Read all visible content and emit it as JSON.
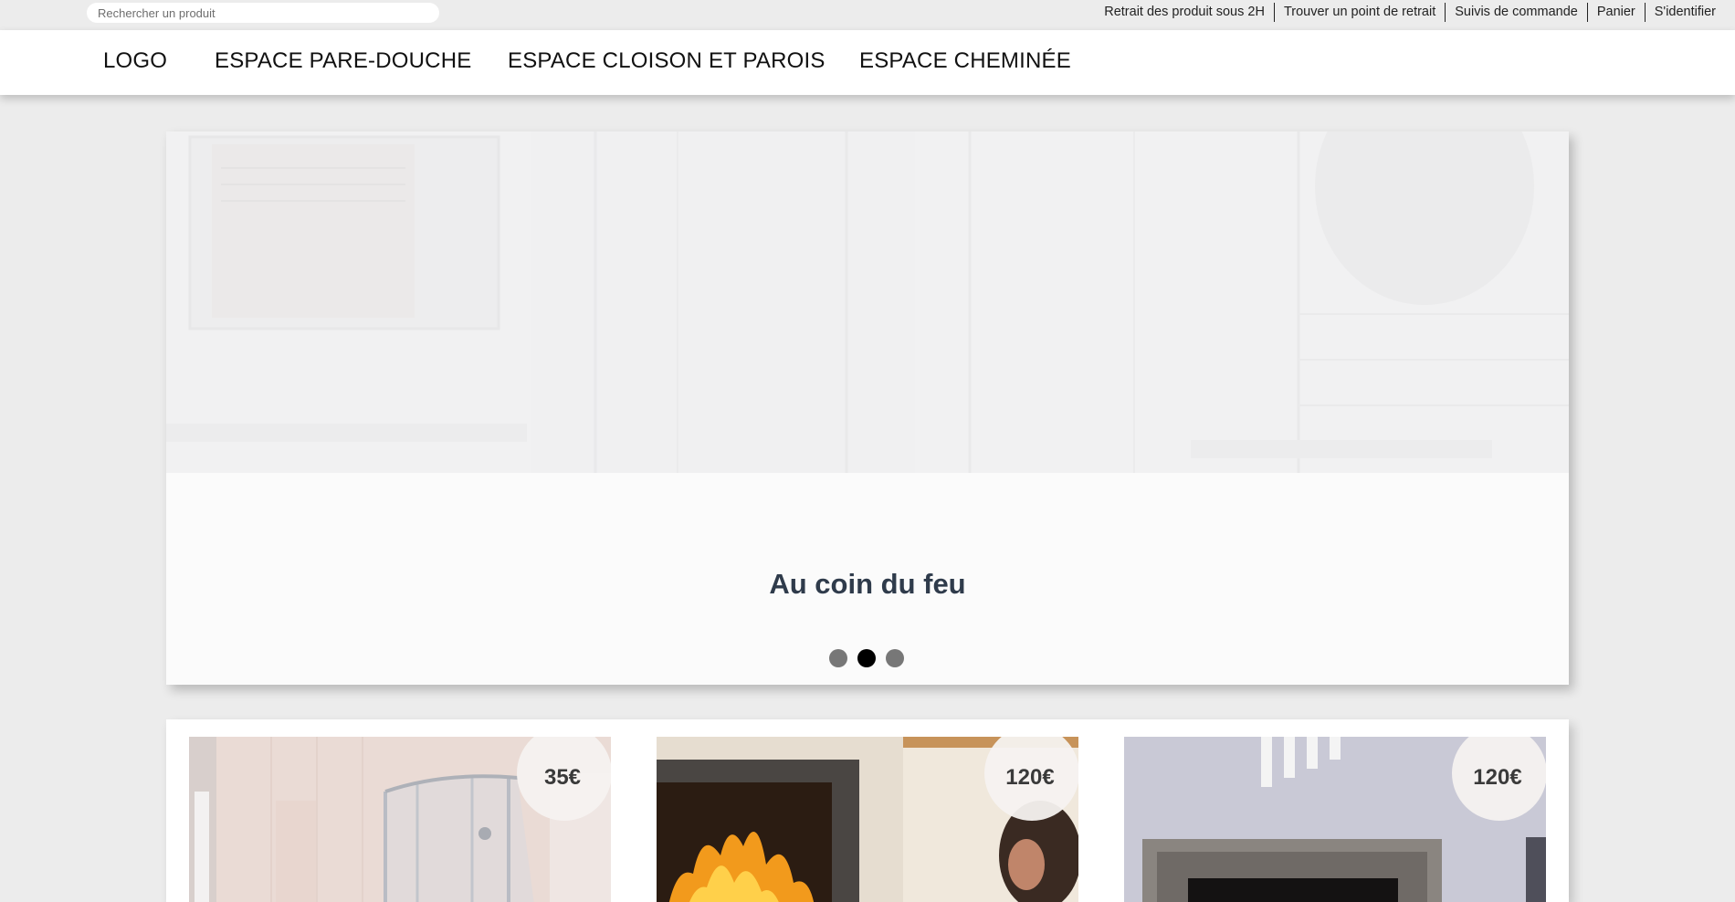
{
  "search": {
    "placeholder": "Rechercher un produit"
  },
  "utility_links": [
    "Retrait des produit sous 2H",
    "Trouver un point de retrait",
    "Suivis de commande",
    "Panier",
    "S'identifier"
  ],
  "nav": {
    "logo": "LOGO",
    "items": [
      "ESPACE PARE-DOUCHE",
      "ESPACE CLOISON ET PAROIS",
      "ESPACE CHEMINÉE"
    ]
  },
  "hero": {
    "title": "Au coin du feu",
    "slide_count": 3,
    "active_slide": 2
  },
  "products": [
    {
      "price": "35€",
      "image": "shower-enclosure"
    },
    {
      "price": "120€",
      "image": "wood-stove-fireplace"
    },
    {
      "price": "120€",
      "image": "modern-fireplace"
    }
  ],
  "colors": {
    "page_bg": "#ececec",
    "title_text": "#2f3b4b",
    "dot_inactive": "#777777",
    "dot_active": "#000000"
  }
}
